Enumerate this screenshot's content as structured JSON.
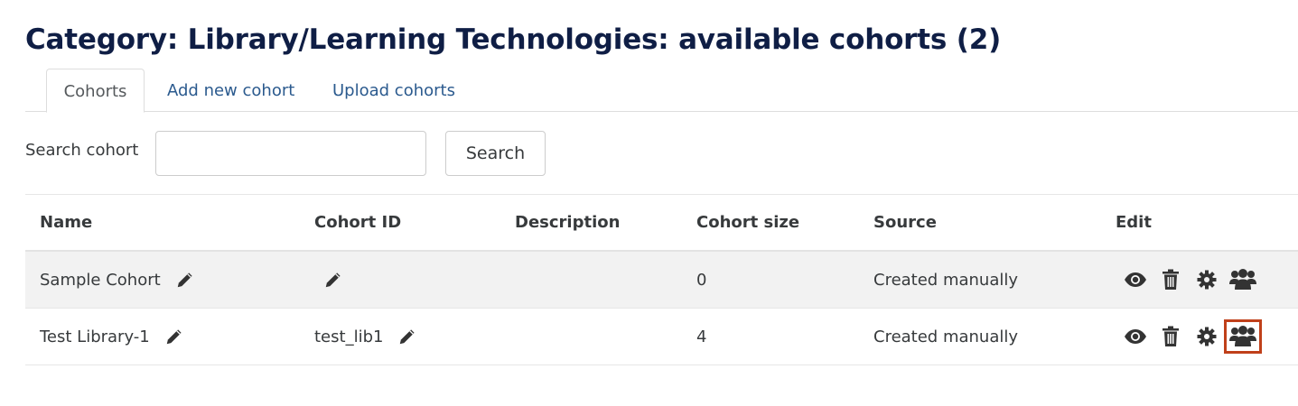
{
  "page": {
    "title": "Category: Library/Learning Technologies: available cohorts (2)"
  },
  "tabs": [
    {
      "label": "Cohorts",
      "active": true
    },
    {
      "label": "Add new cohort",
      "active": false
    },
    {
      "label": "Upload cohorts",
      "active": false
    }
  ],
  "search": {
    "label": "Search cohort",
    "value": "",
    "button_label": "Search"
  },
  "table": {
    "headers": [
      "Name",
      "Cohort ID",
      "Description",
      "Cohort size",
      "Source",
      "Edit"
    ],
    "rows": [
      {
        "name": "Sample Cohort",
        "cohort_id": "",
        "description": "",
        "size": "0",
        "source": "Created manually"
      },
      {
        "name": "Test Library-1",
        "cohort_id": "test_lib1",
        "description": "",
        "size": "4",
        "source": "Created manually"
      }
    ]
  },
  "icons": {
    "edit": "pencil-icon",
    "view": "eye-icon",
    "delete": "trash-icon",
    "settings": "gear-icon",
    "members": "users-icon"
  },
  "colors": {
    "title": "#0f1e45",
    "link": "#2b5a8e",
    "highlight": "#c0401a",
    "stripe": "#f2f2f2"
  }
}
